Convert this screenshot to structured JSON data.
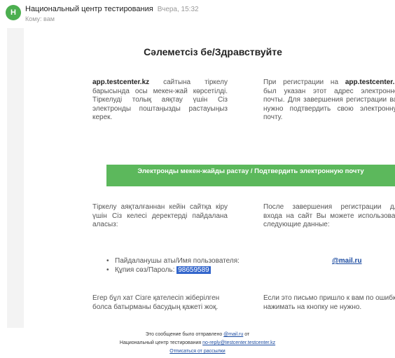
{
  "header": {
    "avatar_letter": "Н",
    "sender": "Национальный центр тестирования",
    "time": "Вчера, 15:32",
    "to": "Кому: вам"
  },
  "email": {
    "greeting": "Сәлеметсіз бе/Здравствуйте",
    "kz_intro_site": "app.testcenter.kz",
    "kz_intro_text": " сайтына тіркелу барысында осы мекен-жай көрсетілді. Тіркелуді толық аяқтау үшін Сіз электронды поштаңызды растауыңыз керек.",
    "ru_intro_text_1": "При регистрации на ",
    "ru_intro_site": "app.testcenter.kz",
    "ru_intro_text_2": " был указан этот адрес электронной почты. Для завершения регистрации вам нужно подтвердить свою электронную почту.",
    "confirm_button": "Электронды мекен-жайды растау / Подтвердить электронную почту",
    "kz_after": "Тіркелу аяқталғаннан кейін сайтқа кіру үшін Сіз келесі деректерді пайдалана аласыз:",
    "ru_after": "После завершения регистрации для входа на сайт Вы можете использовать следующие данные:",
    "username_label": "Пайдаланушы аты/Имя пользователя:",
    "username_value": "@mail.ru",
    "password_label": "Құпия сөз/Пароль:",
    "password_value": "98659589",
    "kz_error": "Егер бұл хат Сізге қателесіп жіберілген болса батырманы басудың қажеті жоқ.",
    "ru_error": "Если это письмо пришло к вам по ошибке, нажимать на кнопку не нужно."
  },
  "footer": {
    "line1_a": "Это сообщение было отправлено",
    "line1_link": "@mail.ru",
    "line1_b": "от",
    "line2_a": "Национальный центр тестирования",
    "line2_link": "no-reply@testcenter.testcenter.kz",
    "unsubscribe": "Отписаться от рассылки"
  },
  "colors": {
    "button": "#5cb85c",
    "avatar": "#4caf50",
    "link": "#1a4aa0",
    "selection": "#3366cc"
  }
}
